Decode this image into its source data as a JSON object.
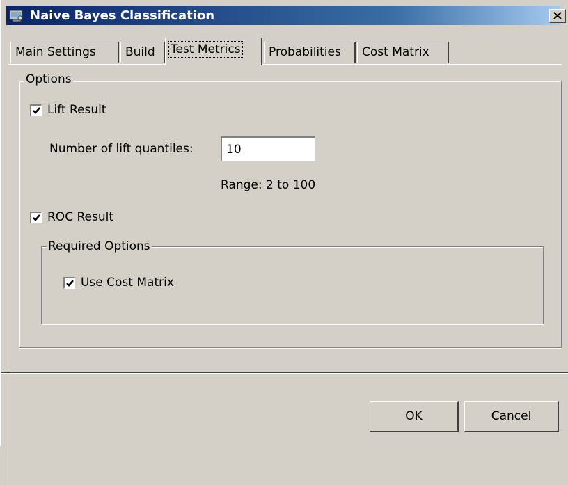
{
  "window": {
    "title": "Naive Bayes Classification",
    "close_label": "×"
  },
  "tabs": [
    {
      "label": "Main Settings",
      "active": false
    },
    {
      "label": "Build",
      "active": false
    },
    {
      "label": "Test Metrics",
      "active": true
    },
    {
      "label": "Probabilities",
      "active": false
    },
    {
      "label": "Cost Matrix",
      "active": false
    }
  ],
  "options_group": {
    "title": "Options",
    "lift_result": {
      "label": "Lift Result",
      "checked": true
    },
    "lift_quantiles": {
      "label": "Number of lift quantiles:",
      "value": "10",
      "range_text": "Range: 2 to 100"
    },
    "roc_result": {
      "label": "ROC Result",
      "checked": true
    },
    "required_options": {
      "title": "Required Options",
      "use_cost_matrix": {
        "label": "Use Cost Matrix",
        "checked": true
      }
    }
  },
  "buttons": {
    "ok": "OK",
    "cancel": "Cancel"
  },
  "colors": {
    "face": "#d4d0c8",
    "title_start": "#0a246a",
    "title_end": "#a6caf0",
    "shadow": "#808080",
    "dark_shadow": "#404040",
    "highlight": "#ffffff"
  },
  "icons": {
    "app": "app-icon",
    "close": "close-icon",
    "check": "checkmark-icon"
  }
}
